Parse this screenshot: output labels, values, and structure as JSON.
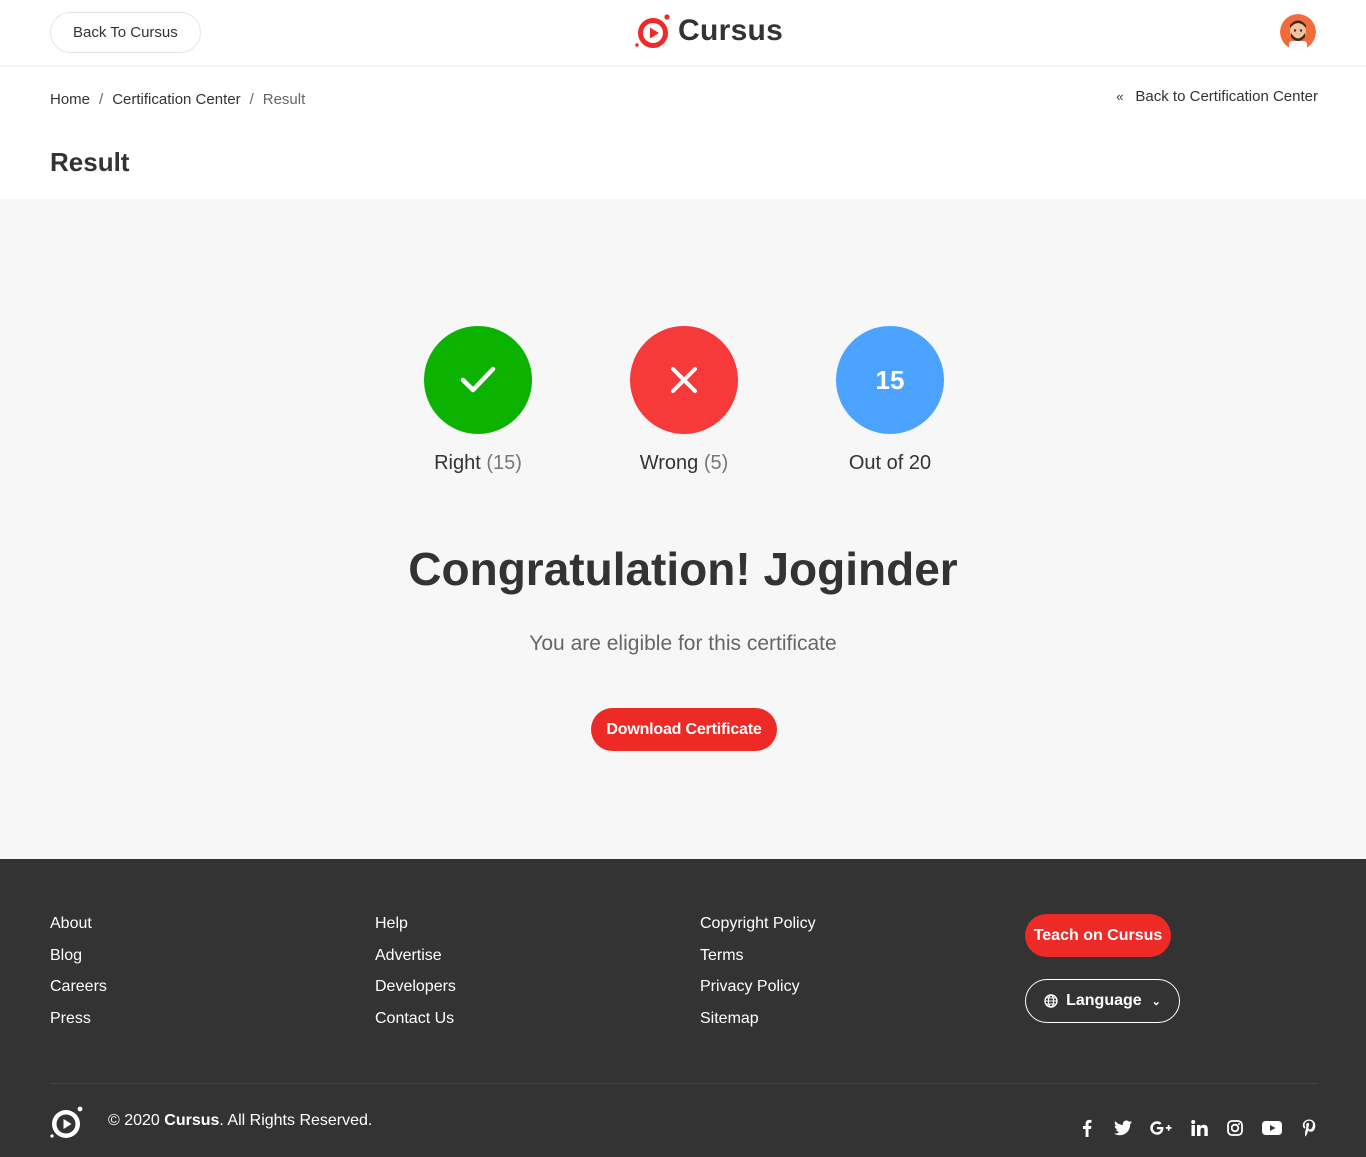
{
  "header": {
    "back_label": "Back To Cursus",
    "brand": "Cursus",
    "brand_color": "#ed2a26"
  },
  "breadcrumb": {
    "items": [
      "Home",
      "Certification Center"
    ],
    "separator": "/",
    "current": "Result"
  },
  "back_link": "Back to Certification Center",
  "page_title": "Result",
  "results": {
    "right_label": "Right",
    "right_count": "(15)",
    "wrong_label": "Wrong",
    "wrong_count": "(5)",
    "score": "15",
    "out_of": "Out of 20",
    "colors": {
      "right": "#0bb300",
      "wrong": "#f63939",
      "score": "#4ba3ff"
    }
  },
  "congrats": "Congratulation! Joginder",
  "eligible": "You are eligible for this certificate",
  "download_label": "Download Certificate",
  "footer": {
    "col1": [
      "About",
      "Blog",
      "Careers",
      "Press"
    ],
    "col2": [
      "Help",
      "Advertise",
      "Developers",
      "Contact Us"
    ],
    "col3": [
      "Copyright Policy",
      "Terms",
      "Privacy Policy",
      "Sitemap"
    ],
    "teach_label": "Teach on Cursus",
    "language_label": "Language",
    "copyright_prefix": "© 2020 ",
    "copyright_brand": "Cursus",
    "copyright_suffix": ". All Rights Reserved.",
    "socials": [
      "facebook-icon",
      "twitter-icon",
      "google-plus-icon",
      "linkedin-icon",
      "instagram-icon",
      "youtube-icon",
      "pinterest-icon"
    ]
  }
}
